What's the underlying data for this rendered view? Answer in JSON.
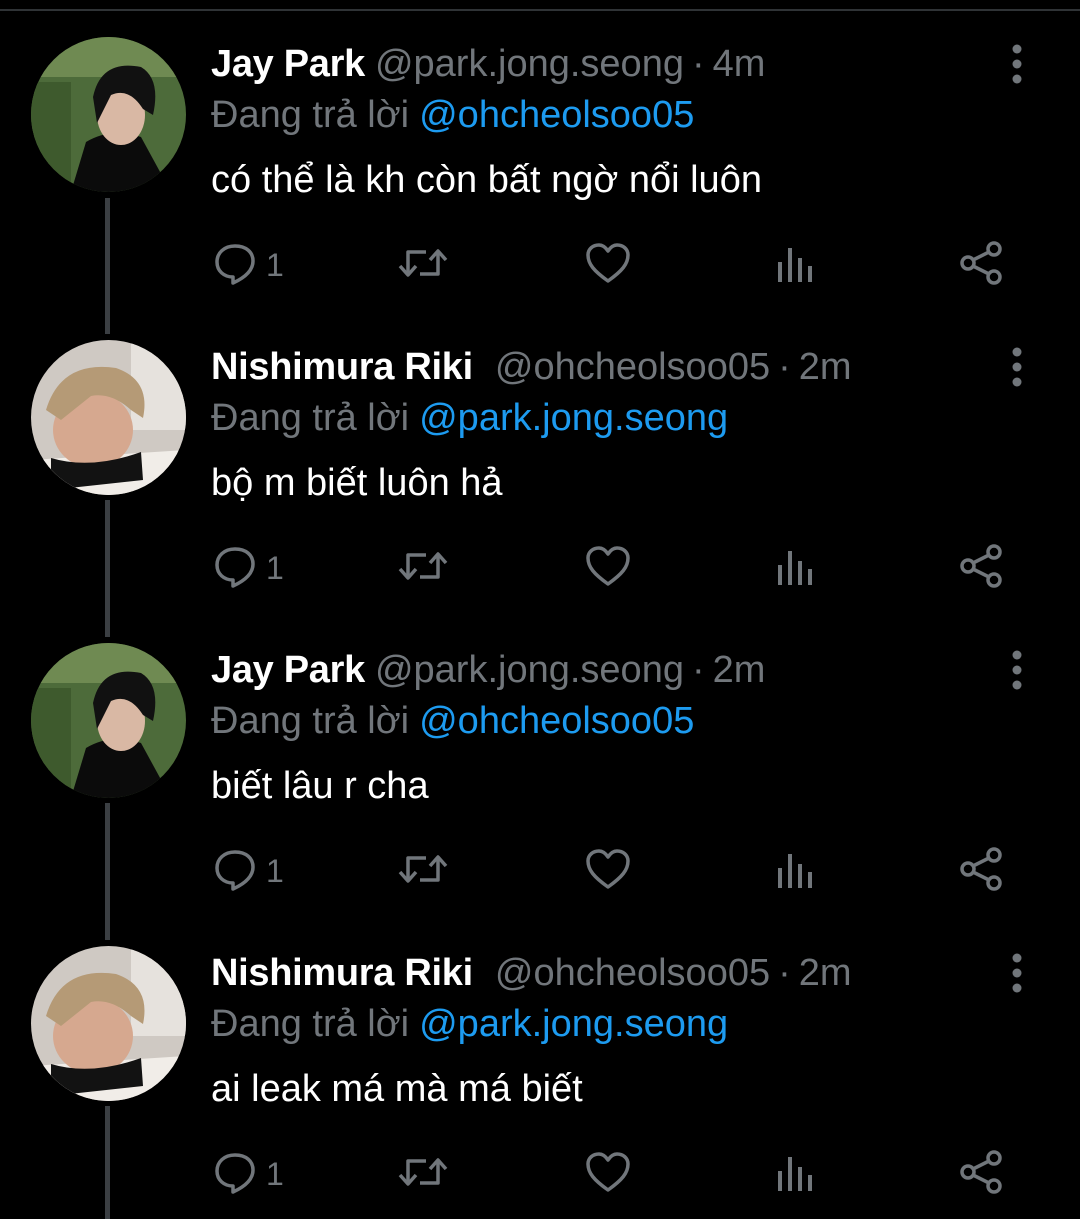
{
  "reply_prefix": "Đang trả lời",
  "colors": {
    "background": "#000000",
    "text_primary": "#ffffff",
    "text_secondary": "#71767b",
    "link": "#1d9bf0",
    "thread_line": "#3b3f43"
  },
  "icons": {
    "reply": "comment-bubble-icon",
    "retweet": "retweet-icon",
    "like": "heart-icon",
    "views": "bar-chart-icon",
    "share": "share-icon",
    "more": "vertical-ellipsis-icon"
  },
  "tweets": [
    {
      "display_name": "Jay Park",
      "handle": "@park.jong.seong",
      "separator": "·",
      "time": "4m",
      "reply_to": "@ohcheolsoo05",
      "text": "có thể là kh còn bất ngờ nổi luôn",
      "reply_count": "1"
    },
    {
      "display_name": "Nishimura Riki",
      "handle": "@ohcheolsoo05",
      "separator": "·",
      "time": "2m",
      "reply_to": "@park.jong.seong",
      "text": "bộ m biết luôn hả",
      "reply_count": "1"
    },
    {
      "display_name": "Jay Park",
      "handle": "@park.jong.seong",
      "separator": "·",
      "time": "2m",
      "reply_to": "@ohcheolsoo05",
      "text": "biết lâu r cha",
      "reply_count": "1"
    },
    {
      "display_name": "Nishimura Riki",
      "handle": "@ohcheolsoo05",
      "separator": "·",
      "time": "2m",
      "reply_to": "@park.jong.seong",
      "text": "ai leak má mà má biết",
      "reply_count": "1"
    }
  ]
}
